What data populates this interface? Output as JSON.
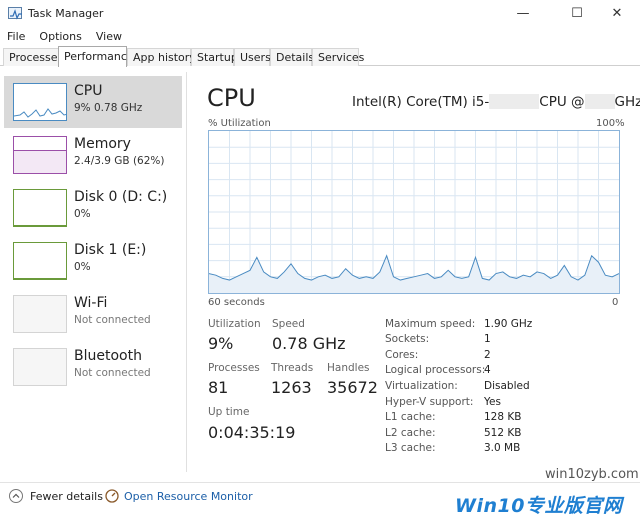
{
  "window": {
    "title": "Task Manager",
    "minimize": "—",
    "maximize": "☐",
    "close": "✕"
  },
  "menu": [
    "File",
    "Options",
    "View"
  ],
  "tabs": [
    "Processes",
    "Performance",
    "App history",
    "Startup",
    "Users",
    "Details",
    "Services"
  ],
  "active_tab": "Performance",
  "sidebar": {
    "items": [
      {
        "name": "CPU",
        "detail": "9% 0.78 GHz"
      },
      {
        "name": "Memory",
        "detail": "2.4/3.9 GB (62%)"
      },
      {
        "name": "Disk 0 (D: C:)",
        "detail": "0%"
      },
      {
        "name": "Disk 1 (E:)",
        "detail": "0%"
      },
      {
        "name": "Wi-Fi",
        "detail": "Not connected"
      },
      {
        "name": "Bluetooth",
        "detail": "Not connected"
      }
    ]
  },
  "main": {
    "title": "CPU",
    "cpu_prefix": "Intel(R) Core(TM) i5-",
    "cpu_middle": "CPU @",
    "cpu_suffix": "GHz",
    "util_label": "% Utilization",
    "max_label": "100%",
    "x_left": "60 seconds",
    "x_right": "0",
    "stats": {
      "utilization_label": "Utilization",
      "utilization": "9%",
      "speed_label": "Speed",
      "speed": "0.78 GHz",
      "processes_label": "Processes",
      "processes": "81",
      "threads_label": "Threads",
      "threads": "1263",
      "handles_label": "Handles",
      "handles": "35672",
      "uptime_label": "Up time",
      "uptime": "0:04:35:19"
    },
    "specs": [
      {
        "label": "Maximum speed:",
        "value": "1.90 GHz"
      },
      {
        "label": "Sockets:",
        "value": "1"
      },
      {
        "label": "Cores:",
        "value": "2"
      },
      {
        "label": "Logical processors:",
        "value": "4"
      },
      {
        "label": "Virtualization:",
        "value": "Disabled"
      },
      {
        "label": "Hyper-V support:",
        "value": "Yes"
      },
      {
        "label": "L1 cache:",
        "value": "128 KB"
      },
      {
        "label": "L2 cache:",
        "value": "512 KB"
      },
      {
        "label": "L3 cache:",
        "value": "3.0 MB"
      }
    ]
  },
  "footer": {
    "fewer_details": "Fewer details",
    "open_resource_monitor": "Open Resource Monitor"
  },
  "watermark": {
    "small": "win10zyb.com",
    "main": "Win10专业版官网"
  },
  "chart_data": {
    "type": "line",
    "ylim": [
      0,
      100
    ],
    "x_range_seconds": [
      60,
      0
    ],
    "values": [
      12,
      11,
      9,
      8,
      10,
      12,
      14,
      22,
      13,
      10,
      9,
      13,
      18,
      12,
      9,
      8,
      10,
      11,
      9,
      10,
      15,
      11,
      9,
      10,
      9,
      13,
      23,
      10,
      8,
      9,
      10,
      11,
      12,
      9,
      10,
      14,
      10,
      9,
      10,
      22,
      9,
      8,
      12,
      13,
      10,
      9,
      11,
      10,
      13,
      12,
      9,
      11,
      17,
      10,
      8,
      11,
      23,
      19,
      11,
      10,
      12
    ]
  },
  "colors": {
    "accent": "#1f7fd1",
    "graph_line": "#4a8bc2",
    "graph_fill": "#e8f0f8",
    "graph_grid": "#d9e6f2",
    "memory_border": "#9b4fa8",
    "disk_border": "#6a9a3a"
  }
}
